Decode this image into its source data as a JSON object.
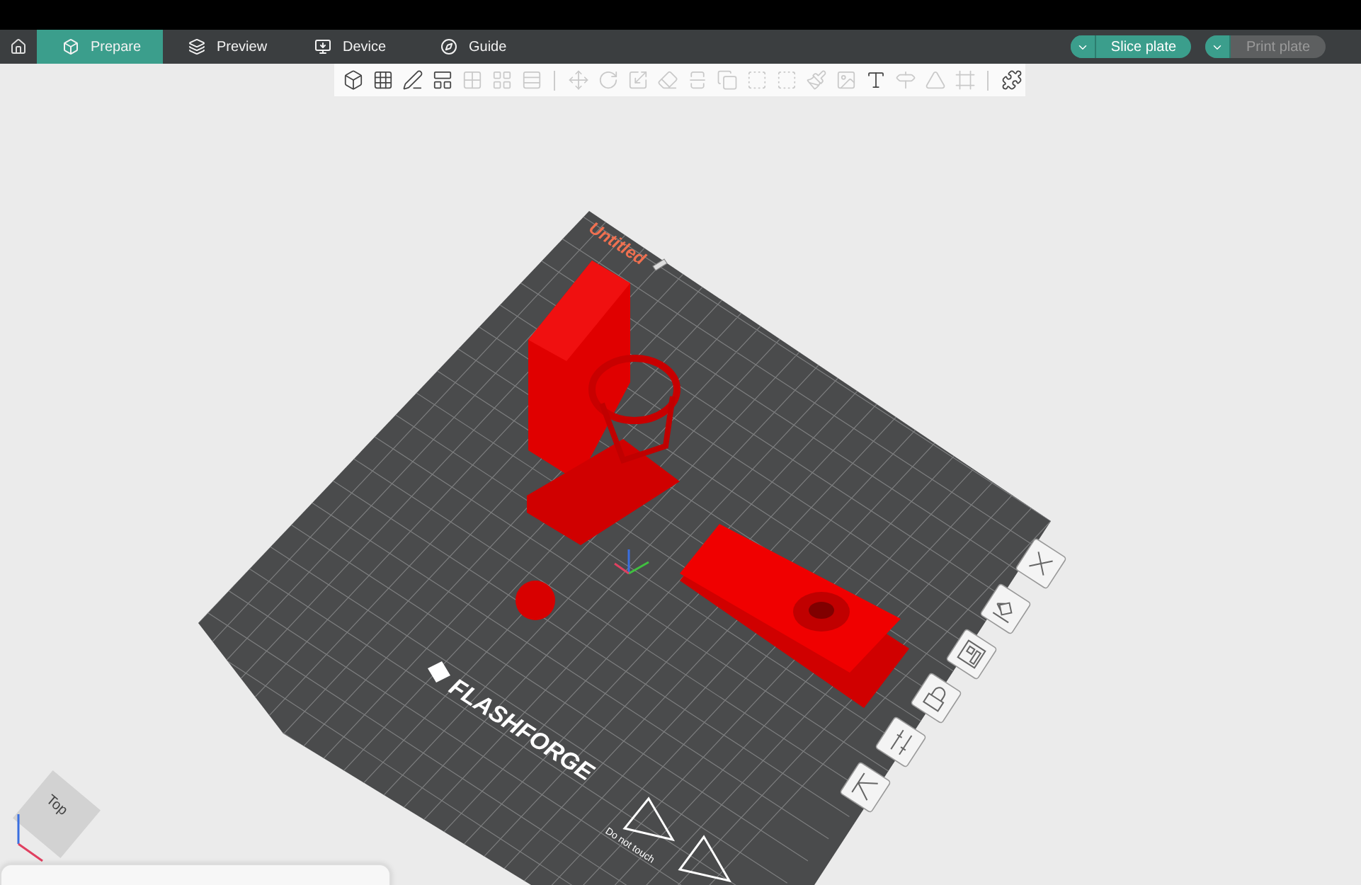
{
  "tabs": [
    {
      "label": "Prepare",
      "selected": true
    },
    {
      "label": "Preview",
      "selected": false
    },
    {
      "label": "Device",
      "selected": false
    },
    {
      "label": "Guide",
      "selected": false
    }
  ],
  "actions": [
    {
      "label": "Slice plate",
      "disabled": false
    },
    {
      "label": "Print plate",
      "disabled": true
    }
  ],
  "toolbar": [
    {
      "kind": "tool",
      "disabled": false
    },
    {
      "kind": "tool",
      "disabled": false
    },
    {
      "kind": "tool",
      "disabled": false
    },
    {
      "kind": "tool",
      "disabled": false
    },
    {
      "kind": "tool",
      "disabled": true
    },
    {
      "kind": "tool",
      "disabled": true
    },
    {
      "kind": "tool",
      "disabled": true
    },
    {
      "kind": "separator"
    },
    {
      "kind": "tool",
      "disabled": true
    },
    {
      "kind": "tool",
      "disabled": true
    },
    {
      "kind": "tool",
      "disabled": true
    },
    {
      "kind": "tool",
      "disabled": true
    },
    {
      "kind": "tool",
      "disabled": true
    },
    {
      "kind": "tool",
      "disabled": true
    },
    {
      "kind": "tool",
      "disabled": true
    },
    {
      "kind": "tool",
      "disabled": true
    },
    {
      "kind": "tool",
      "disabled": true
    },
    {
      "kind": "tool",
      "disabled": true
    },
    {
      "kind": "tool",
      "disabled": false
    },
    {
      "kind": "tool",
      "disabled": true
    },
    {
      "kind": "tool",
      "disabled": true
    },
    {
      "kind": "tool",
      "disabled": true
    },
    {
      "kind": "separator"
    },
    {
      "kind": "tool",
      "disabled": false
    }
  ],
  "plate": {
    "name": "Untitled",
    "brand": "FLASHFORGE",
    "warning": "Do not touch"
  },
  "view_cube": {
    "face": "Top"
  }
}
